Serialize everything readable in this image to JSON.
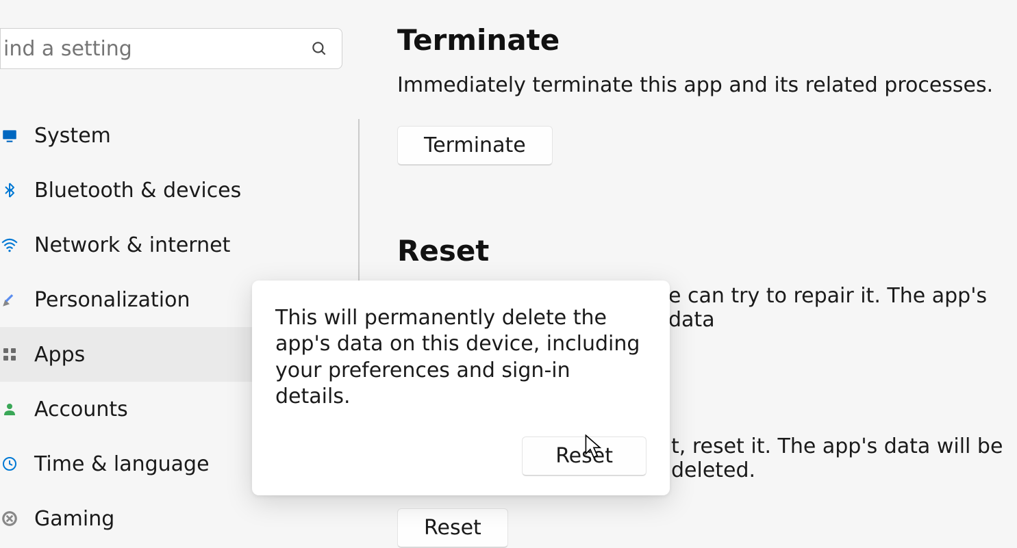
{
  "search": {
    "placeholder": "ind a setting"
  },
  "sidebar": {
    "items": [
      {
        "label": "System",
        "icon": "system"
      },
      {
        "label": "Bluetooth & devices",
        "icon": "bluetooth"
      },
      {
        "label": "Network & internet",
        "icon": "network"
      },
      {
        "label": "Personalization",
        "icon": "personalization"
      },
      {
        "label": "Apps",
        "icon": "apps"
      },
      {
        "label": "Accounts",
        "icon": "accounts"
      },
      {
        "label": "Time & language",
        "icon": "time"
      },
      {
        "label": "Gaming",
        "icon": "gaming"
      }
    ],
    "selected_index": 4
  },
  "terminate": {
    "title": "Terminate",
    "desc": "Immediately terminate this app and its related processes.",
    "button": "Terminate"
  },
  "reset": {
    "title": "Reset",
    "desc_partial_right": "e can try to repair it. The app's data",
    "desc2_partial": "t, reset it. The app's data will be deleted.",
    "button": "Reset"
  },
  "popover": {
    "text": "This will permanently delete the app's data on this device, including your preferences and sign-in details.",
    "confirm": "Reset"
  }
}
